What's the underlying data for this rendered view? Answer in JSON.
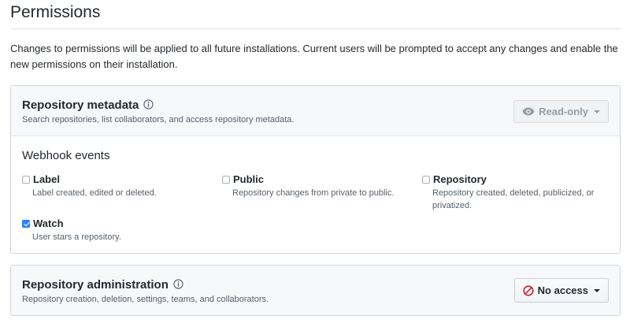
{
  "page": {
    "title": "Permissions",
    "intro": "Changes to permissions will be applied to all future installations. Current users will be prompted to accept any changes and enable the new permissions on their installation."
  },
  "metadata": {
    "title": "Repository metadata",
    "description": "Search repositories, list collaborators, and access repository metadata.",
    "button_label": "Read-only",
    "button_icon": "eye-icon",
    "button_disabled": true
  },
  "webhooks": {
    "title": "Webhook events",
    "events": [
      {
        "label": "Label",
        "description": "Label created, edited or deleted.",
        "checked": false
      },
      {
        "label": "Public",
        "description": "Repository changes from private to public.",
        "checked": false
      },
      {
        "label": "Repository",
        "description": "Repository created, deleted, publicized, or privatized.",
        "checked": false
      },
      {
        "label": "Watch",
        "description": "User stars a repository.",
        "checked": true
      }
    ]
  },
  "administration": {
    "title": "Repository administration",
    "description": "Repository creation, deletion, settings, teams, and collaborators.",
    "button_label": "No access",
    "button_icon": "no-entry-icon"
  },
  "colors": {
    "checkbox_checked": "#2188ff",
    "no_access_icon": "#cb2431",
    "muted_text": "#586069"
  }
}
